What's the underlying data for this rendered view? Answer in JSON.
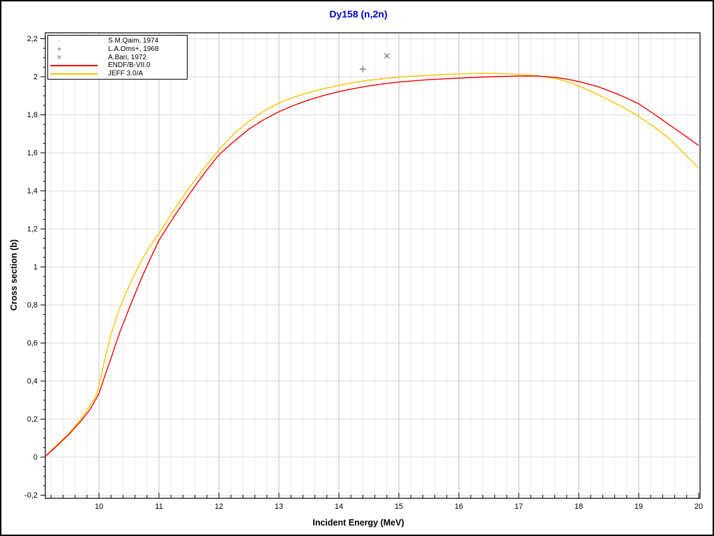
{
  "window": {
    "bg_color": "#ffffff",
    "border_color": "#000000"
  },
  "title": "Dy158 (n,2n)",
  "title_color": "#0000cc",
  "chart_data": {
    "type": "line",
    "title": "Dy158 (n,2n)",
    "xlabel": "Incident Energy (MeV)",
    "ylabel": "Cross section (b)",
    "xlim": [
      9.105,
      20.023
    ],
    "ylim": [
      -0.2165,
      2.2312
    ],
    "grid": true,
    "legend_position": "top-left",
    "x_major_ticks": [
      10,
      11,
      12,
      13,
      14,
      15,
      16,
      17,
      18,
      19,
      20
    ],
    "x_tick_labels": [
      "10",
      "11",
      "12",
      "13",
      "14",
      "15",
      "16",
      "17",
      "18",
      "19",
      "20"
    ],
    "x_minor_step": 0.2,
    "y_major_ticks": [
      -0.2,
      0,
      0.2,
      0.4,
      0.6,
      0.8,
      1,
      1.2,
      1.4,
      1.6,
      1.8,
      2,
      2.2
    ],
    "y_tick_labels": [
      "-0,2",
      "0",
      "0,2",
      "0,4",
      "0,6",
      "0,8",
      "1",
      "1,2",
      "1,4",
      "1,6",
      "1,8",
      "2",
      "2,2"
    ],
    "y_minor_step": 0.05,
    "grid_colors": {
      "major_vertical": "#c2c2c2",
      "minor_vertical": "#ededed",
      "horizontal": "#dcdcdc"
    },
    "series": [
      {
        "name": "S.M.Qaim, 1974",
        "kind": "scatter",
        "marker": "dot",
        "color": "#b89c9c",
        "legend_glyph": "·",
        "points": [
          [
            14.7,
            1.99
          ]
        ]
      },
      {
        "name": "L.A.Oms+, 1968",
        "kind": "scatter",
        "marker": "plus",
        "color": "#6e6e6e",
        "legend_glyph": "+",
        "points": [
          [
            14.4,
            2.04
          ]
        ]
      },
      {
        "name": "A.Bari, 1972",
        "kind": "scatter",
        "marker": "x",
        "color": "#8d6666",
        "legend_glyph": "×",
        "points": [
          [
            14.8,
            2.11
          ]
        ]
      },
      {
        "name": "ENDF/B-VII.0",
        "kind": "line",
        "color": "#f40000",
        "points": [
          [
            9.11,
            0.005
          ],
          [
            9.3,
            0.06
          ],
          [
            9.5,
            0.12
          ],
          [
            9.7,
            0.19
          ],
          [
            9.85,
            0.25
          ],
          [
            10.0,
            0.335
          ],
          [
            10.1,
            0.43
          ],
          [
            10.2,
            0.52
          ],
          [
            10.35,
            0.66
          ],
          [
            10.5,
            0.78
          ],
          [
            10.7,
            0.935
          ],
          [
            10.85,
            1.04
          ],
          [
            11.0,
            1.14
          ],
          [
            11.25,
            1.265
          ],
          [
            11.5,
            1.38
          ],
          [
            11.75,
            1.49
          ],
          [
            12.0,
            1.59
          ],
          [
            12.25,
            1.66
          ],
          [
            12.5,
            1.725
          ],
          [
            12.75,
            1.775
          ],
          [
            13.0,
            1.816
          ],
          [
            13.25,
            1.85
          ],
          [
            13.5,
            1.878
          ],
          [
            13.75,
            1.902
          ],
          [
            14.0,
            1.922
          ],
          [
            14.25,
            1.938
          ],
          [
            14.5,
            1.952
          ],
          [
            14.75,
            1.963
          ],
          [
            15.0,
            1.972
          ],
          [
            15.5,
            1.985
          ],
          [
            16.0,
            1.993
          ],
          [
            16.5,
            2.0
          ],
          [
            17.0,
            2.004
          ],
          [
            17.3,
            2.004
          ],
          [
            17.6,
            1.997
          ],
          [
            17.8,
            1.988
          ],
          [
            18.0,
            1.975
          ],
          [
            18.3,
            1.95
          ],
          [
            18.6,
            1.915
          ],
          [
            18.8,
            1.888
          ],
          [
            19.0,
            1.858
          ],
          [
            19.25,
            1.805
          ],
          [
            19.5,
            1.75
          ],
          [
            19.75,
            1.695
          ],
          [
            20.0,
            1.638
          ]
        ]
      },
      {
        "name": "JEFF 3.0/A",
        "kind": "line",
        "color": "#fdc300",
        "points": [
          [
            9.11,
            0.007
          ],
          [
            9.3,
            0.065
          ],
          [
            9.5,
            0.125
          ],
          [
            9.7,
            0.2
          ],
          [
            9.85,
            0.27
          ],
          [
            9.95,
            0.325
          ],
          [
            10.0,
            0.375
          ],
          [
            10.1,
            0.52
          ],
          [
            10.2,
            0.645
          ],
          [
            10.35,
            0.79
          ],
          [
            10.5,
            0.9
          ],
          [
            10.7,
            1.03
          ],
          [
            10.85,
            1.11
          ],
          [
            11.0,
            1.175
          ],
          [
            11.25,
            1.3
          ],
          [
            11.5,
            1.415
          ],
          [
            11.75,
            1.52
          ],
          [
            12.0,
            1.615
          ],
          [
            12.25,
            1.7
          ],
          [
            12.5,
            1.765
          ],
          [
            12.75,
            1.82
          ],
          [
            12.9,
            1.845
          ],
          [
            13.0,
            1.862
          ],
          [
            13.25,
            1.893
          ],
          [
            13.5,
            1.917
          ],
          [
            13.75,
            1.938
          ],
          [
            14.0,
            1.955
          ],
          [
            14.25,
            1.97
          ],
          [
            14.5,
            1.982
          ],
          [
            15.0,
            1.998
          ],
          [
            15.5,
            2.008
          ],
          [
            16.0,
            2.015
          ],
          [
            16.4,
            2.018
          ],
          [
            16.8,
            2.016
          ],
          [
            17.0,
            2.012
          ],
          [
            17.3,
            2.005
          ],
          [
            17.6,
            1.992
          ],
          [
            17.8,
            1.975
          ],
          [
            18.0,
            1.952
          ],
          [
            18.25,
            1.917
          ],
          [
            18.5,
            1.878
          ],
          [
            18.75,
            1.838
          ],
          [
            19.0,
            1.792
          ],
          [
            19.25,
            1.738
          ],
          [
            19.5,
            1.678
          ],
          [
            19.75,
            1.6
          ],
          [
            20.0,
            1.52
          ]
        ]
      }
    ]
  }
}
